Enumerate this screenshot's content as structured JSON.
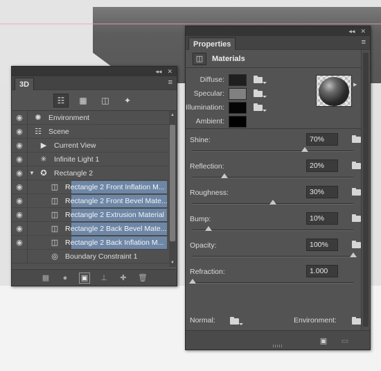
{
  "panel_3d": {
    "tab": "3D",
    "chrome": {
      "collapse": "◂◂",
      "close": "✕"
    },
    "menu": "≡",
    "filters": [
      {
        "name": "scene",
        "glyph": "☷",
        "active": true
      },
      {
        "name": "meshes",
        "glyph": "▦",
        "active": false
      },
      {
        "name": "materials",
        "glyph": "◫",
        "active": false
      },
      {
        "name": "lights",
        "glyph": "✦",
        "active": false
      }
    ],
    "rows": [
      {
        "label": "Environment",
        "icon": "✺",
        "indent": 0,
        "selected": false,
        "eye": true
      },
      {
        "label": "Scene",
        "icon": "☷",
        "indent": 0,
        "selected": false,
        "eye": true
      },
      {
        "label": "Current View",
        "icon": "▶",
        "indent": 1,
        "selected": false,
        "eye": true
      },
      {
        "label": "Infinite Light 1",
        "icon": "✳",
        "indent": 1,
        "selected": false,
        "eye": true
      },
      {
        "label": "Rectangle 2",
        "icon": "✪",
        "indent": 1,
        "selected": false,
        "eye": true,
        "expanded": true
      },
      {
        "label": "Rectangle 2 Front Inflation M...",
        "icon": "◫",
        "indent": 2,
        "selected": true,
        "eye": true
      },
      {
        "label": "Rectangle 2 Front Bevel Mate...",
        "icon": "◫",
        "indent": 2,
        "selected": true,
        "eye": true
      },
      {
        "label": "Rectangle 2 Extrusion Material",
        "icon": "◫",
        "indent": 2,
        "selected": true,
        "eye": true
      },
      {
        "label": "Rectangle 2 Back Bevel Mate...",
        "icon": "◫",
        "indent": 2,
        "selected": true,
        "eye": true
      },
      {
        "label": "Rectangle 2 Back Inflation M...",
        "icon": "◫",
        "indent": 2,
        "selected": true,
        "eye": true
      },
      {
        "label": "Boundary Constraint 1",
        "icon": "◎",
        "indent": 2,
        "selected": false,
        "eye": false
      }
    ],
    "bottom_icons": [
      {
        "name": "mesh-icon",
        "glyph": "▦",
        "on": false
      },
      {
        "name": "light-bulb-icon",
        "glyph": "●",
        "on": false
      },
      {
        "name": "render-icon",
        "glyph": "▣",
        "on": true
      },
      {
        "name": "ground-icon",
        "glyph": "⊥",
        "on": false
      },
      {
        "name": "add-light-icon",
        "glyph": "✚",
        "on": false
      },
      {
        "name": "trash-icon",
        "glyph": "🗑",
        "on": false
      }
    ]
  },
  "panel_props": {
    "tab": "Properties",
    "chrome": {
      "collapse": "◂◂",
      "close": "✕"
    },
    "menu": "≡",
    "header": {
      "icon": "◫",
      "title": "Materials"
    },
    "materials": [
      {
        "label": "Diffuse:",
        "color": "#1f1f1f"
      },
      {
        "label": "Specular:",
        "color": "#808080"
      },
      {
        "label": "Illumination:",
        "color": "#050505"
      },
      {
        "label": "Ambient:",
        "color": "#000000"
      }
    ],
    "sliders": [
      {
        "label": "Shine:",
        "value": "70%",
        "level": 0.7
      },
      {
        "label": "Reflection:",
        "value": "20%",
        "level": 0.2
      },
      {
        "label": "Roughness:",
        "value": "30%",
        "level": 0.5
      },
      {
        "label": "Bump:",
        "value": "10%",
        "level": 0.1
      },
      {
        "label": "Opacity:",
        "value": "100%",
        "level": 1.0
      },
      {
        "label": "Refraction:",
        "value": "1.000",
        "level": 0.0
      }
    ],
    "normal_label": "Normal:",
    "environment_label": "Environment:"
  }
}
